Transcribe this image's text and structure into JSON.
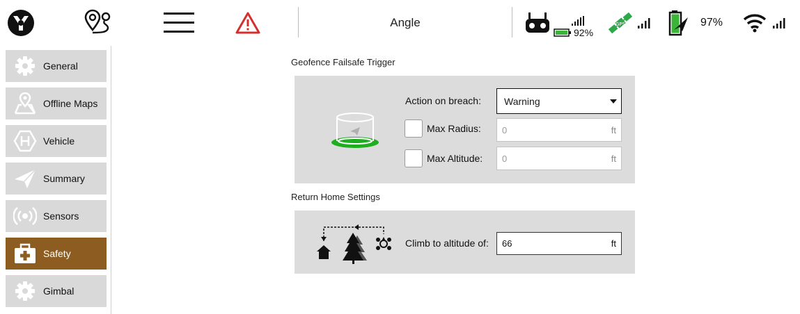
{
  "header": {
    "flight_mode": "Angle",
    "rc_battery_percent": "92%",
    "vehicle_battery_percent": "97%"
  },
  "colors": {
    "accent_active": "#8d5c20",
    "geofence_green": "#1fae1f",
    "warning_red": "#d32f2f"
  },
  "sidebar": {
    "items": [
      {
        "label": "General",
        "icon": "gear-icon"
      },
      {
        "label": "Offline Maps",
        "icon": "map-icon"
      },
      {
        "label": "Vehicle",
        "icon": "vehicle-icon"
      },
      {
        "label": "Summary",
        "icon": "paper-plane-icon"
      },
      {
        "label": "Sensors",
        "icon": "sensors-icon"
      },
      {
        "label": "Safety",
        "icon": "first-aid-icon"
      },
      {
        "label": "Gimbal",
        "icon": "gear-icon"
      }
    ],
    "active_item": "Safety"
  },
  "geofence": {
    "section_title": "Geofence Failsafe Trigger",
    "action_label": "Action on breach:",
    "action_value": "Warning",
    "max_radius_label": "Max Radius:",
    "max_radius_value": "0",
    "max_radius_unit": "ft",
    "max_altitude_label": "Max Altitude:",
    "max_altitude_value": "0",
    "max_altitude_unit": "ft"
  },
  "return_home": {
    "section_title": "Return Home Settings",
    "climb_label": "Climb to altitude of:",
    "climb_value": "66",
    "climb_unit": "ft"
  }
}
